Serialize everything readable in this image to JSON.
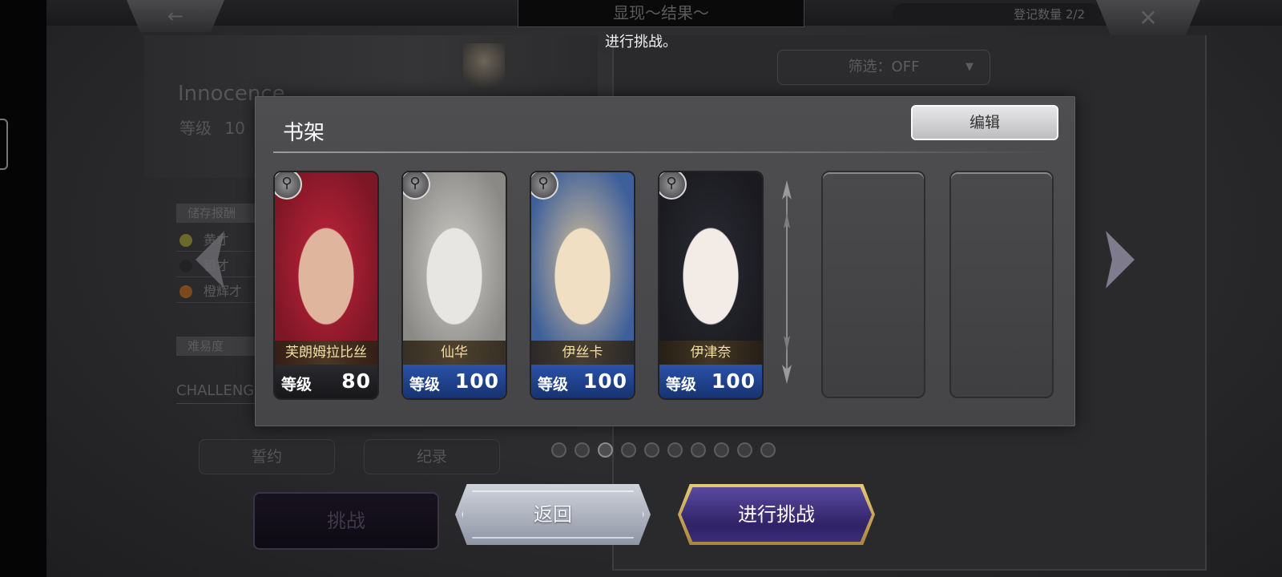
{
  "header": {
    "title": "显现～结果～",
    "registration_count": "登记数量 2/2",
    "back_icon": "arrow-left-icon",
    "close_icon": "close-icon"
  },
  "subtitle": "进行挑战。",
  "background": {
    "character_name": "Innocence",
    "level_label": "等级",
    "level_value": "10",
    "reward_section": "储存报酬",
    "rewards": [
      "黄才",
      "铅才",
      "橙辉才"
    ],
    "difficulty_section": "难易度",
    "difficulty_value": "CHALLENG",
    "pledge_button": "誓约",
    "record_button": "纪录",
    "challenge_button": "挑战",
    "filter_label": "筛选：OFF"
  },
  "shelf": {
    "title": "书架",
    "edit_button": "编辑",
    "cards": [
      {
        "name": "芙朗姆拉比丝",
        "level_label": "等级",
        "level": "80",
        "plate": "dark",
        "badge_icon": "staff-icon",
        "palette": [
          "#e0b59e",
          "#c2253a",
          "#7d1626"
        ]
      },
      {
        "name": "仙华",
        "level_label": "等级",
        "level": "100",
        "plate": "blue",
        "badge_icon": "staff-icon",
        "palette": [
          "#e8e6e2",
          "#cfcdc8",
          "#8a8986"
        ]
      },
      {
        "name": "伊丝卡",
        "level_label": "等级",
        "level": "100",
        "plate": "blue",
        "badge_icon": "sword-icon",
        "palette": [
          "#f1dfc4",
          "#d9c29a",
          "#3d5f9a"
        ]
      },
      {
        "name": "伊津奈",
        "level_label": "等级",
        "level": "100",
        "plate": "blue",
        "badge_icon": "staff-icon",
        "palette": [
          "#f3ece6",
          "#2b2b33",
          "#1a1a20"
        ]
      }
    ],
    "empty_slots": 2,
    "pages": 10,
    "active_page": 3
  },
  "actions": {
    "return_button": "返回",
    "challenge_button": "进行挑战"
  },
  "colors": {
    "accent_gold": "#e6c977",
    "accent_purple": "#3b2d7a",
    "level_blue": "#2b52a8"
  }
}
